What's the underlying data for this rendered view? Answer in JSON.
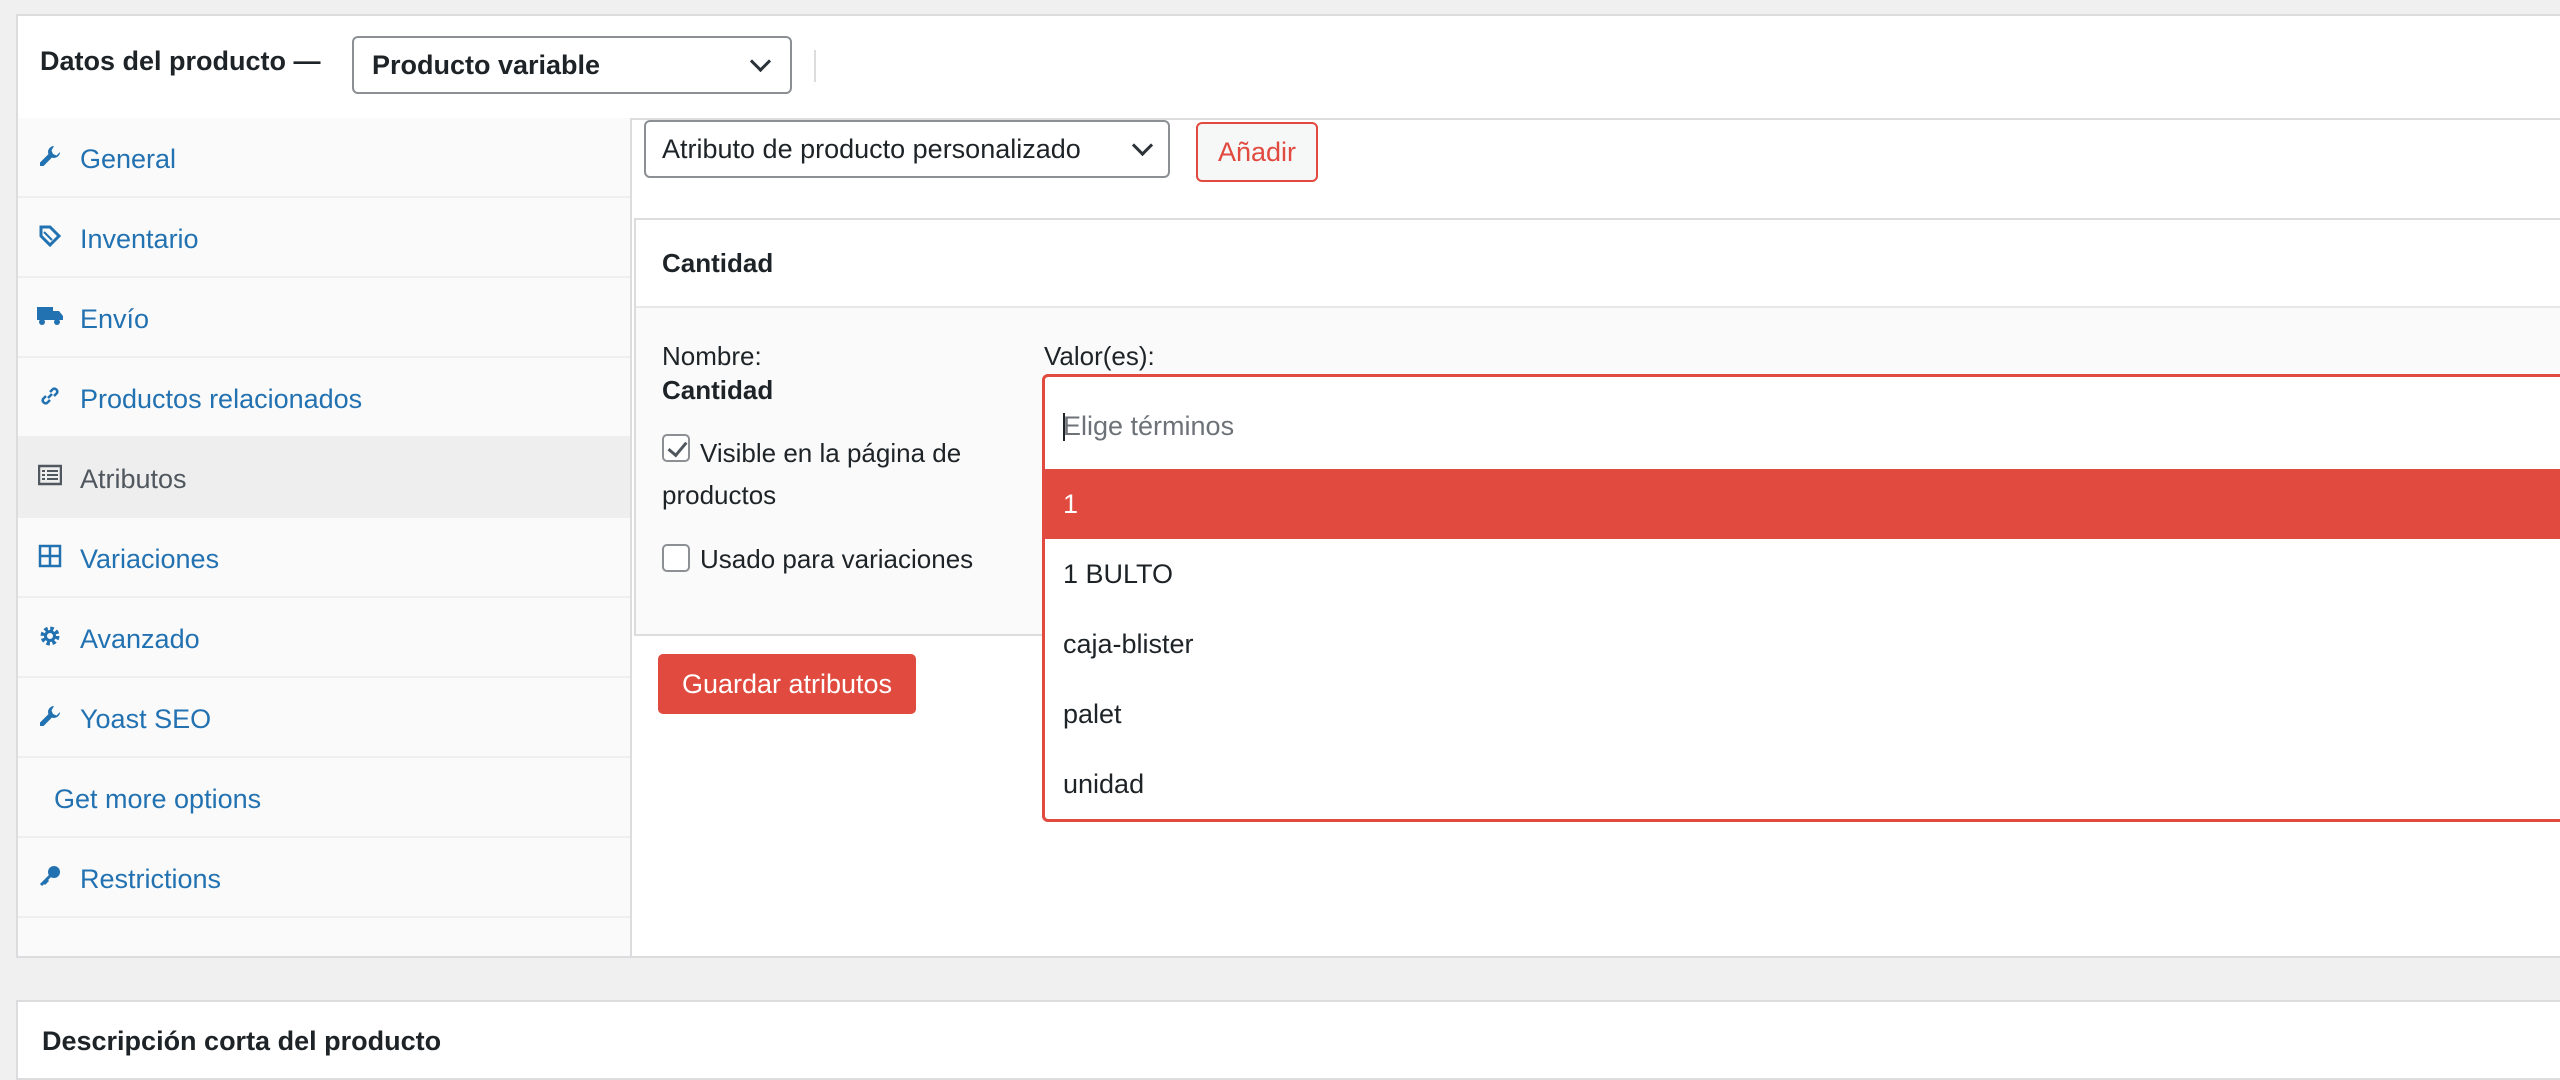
{
  "product_data": {
    "title": "Datos del producto —",
    "product_type": "Producto variable"
  },
  "sidebar": {
    "items": [
      {
        "label": "General",
        "icon": "wrench-icon",
        "active": false
      },
      {
        "label": "Inventario",
        "icon": "tag-icon",
        "active": false
      },
      {
        "label": "Envío",
        "icon": "truck-icon",
        "active": false
      },
      {
        "label": "Productos relacionados",
        "icon": "link-icon",
        "active": false
      },
      {
        "label": "Atributos",
        "icon": "list-icon",
        "active": true
      },
      {
        "label": "Variaciones",
        "icon": "grid-icon",
        "active": false
      },
      {
        "label": "Avanzado",
        "icon": "gear-icon",
        "active": false
      },
      {
        "label": "Yoast SEO",
        "icon": "wrench-icon",
        "active": false
      },
      {
        "label": "Get more options",
        "icon": "",
        "active": false
      },
      {
        "label": "Restrictions",
        "icon": "key-icon",
        "active": false
      }
    ]
  },
  "attributes": {
    "select_value": "Atributo de producto personalizado",
    "add_label": "Añadir",
    "panel_title": "Cantidad",
    "name_label": "Nombre:",
    "name_value": "Cantidad",
    "values_label": "Valor(es):",
    "visible_label_1": "Visible en la página de",
    "visible_label_2": "productos",
    "visible_checked": true,
    "variations_label": "Usado para variaciones",
    "variations_checked": false,
    "save_label": "Guardar atributos"
  },
  "dropdown": {
    "placeholder": "Elige términos",
    "options": [
      "1",
      "1 BULTO",
      "caja-blister",
      "palet",
      "unidad"
    ],
    "highlighted_index": 0
  },
  "short_description": {
    "title": "Descripción corta del producto"
  },
  "colors": {
    "accent": "#e04a3f",
    "link": "#2271b1"
  }
}
